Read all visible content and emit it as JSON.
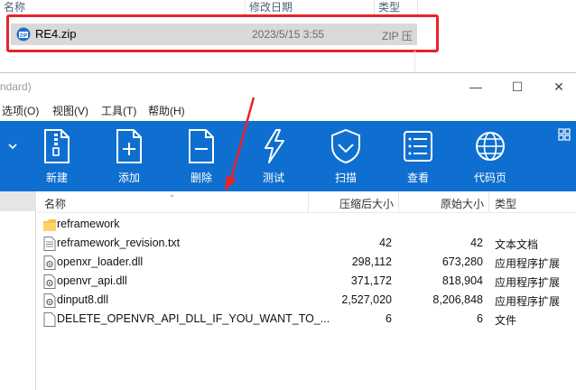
{
  "explorer": {
    "columns": [
      "名称",
      "修改日期",
      "类型"
    ],
    "file": {
      "name": "RE4.zip",
      "date": "2023/5/15 3:55",
      "type": "ZIP 压"
    }
  },
  "window": {
    "title": "ndard)",
    "controls": {
      "minimize": "—",
      "maximize": "☐",
      "close": "✕"
    }
  },
  "menu": [
    "选项(O)",
    "视图(V)",
    "工具(T)",
    "帮助(H)"
  ],
  "toolbar": {
    "buttons": [
      {
        "label": "新建",
        "icon": "new-archive-icon"
      },
      {
        "label": "添加",
        "icon": "add-icon"
      },
      {
        "label": "删除",
        "icon": "delete-icon"
      },
      {
        "label": "测试",
        "icon": "test-icon"
      },
      {
        "label": "扫描",
        "icon": "scan-icon"
      },
      {
        "label": "查看",
        "icon": "view-icon"
      },
      {
        "label": "代码页",
        "icon": "codepage-icon"
      }
    ],
    "color": "#0f6fd0"
  },
  "list": {
    "headers": {
      "name": "名称",
      "packed": "压缩后大小",
      "original": "原始大小",
      "type": "类型"
    },
    "rows": [
      {
        "name": "reframework",
        "packed": "",
        "original": "",
        "type": "",
        "icon": "folder-icon"
      },
      {
        "name": "reframework_revision.txt",
        "packed": "42",
        "original": "42",
        "type": "文本文档",
        "icon": "text-file-icon"
      },
      {
        "name": "openxr_loader.dll",
        "packed": "298,112",
        "original": "673,280",
        "type": "应用程序扩展",
        "icon": "dll-file-icon"
      },
      {
        "name": "openvr_api.dll",
        "packed": "371,172",
        "original": "818,904",
        "type": "应用程序扩展",
        "icon": "dll-file-icon"
      },
      {
        "name": "dinput8.dll",
        "packed": "2,527,020",
        "original": "8,206,848",
        "type": "应用程序扩展",
        "icon": "dll-file-icon"
      },
      {
        "name": "DELETE_OPENVR_API_DLL_IF_YOU_WANT_TO_...",
        "packed": "6",
        "original": "6",
        "type": "文件",
        "icon": "blank-file-icon"
      }
    ]
  },
  "accent": {
    "highlight": "#e8232a"
  }
}
